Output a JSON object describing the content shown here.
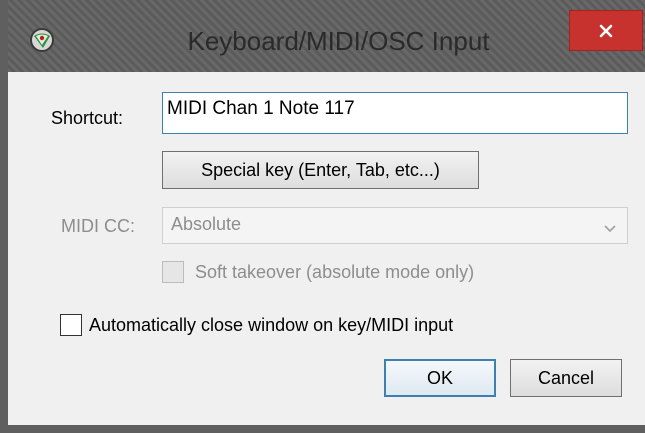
{
  "window": {
    "title": "Keyboard/MIDI/OSC Input"
  },
  "shortcut": {
    "label": "Shortcut:",
    "value": "MIDI Chan 1 Note 117"
  },
  "special_key_button": "Special key (Enter, Tab, etc...)",
  "midi_cc": {
    "label": "MIDI CC:",
    "selected": "Absolute"
  },
  "soft_takeover": {
    "label": "Soft takeover (absolute mode only)",
    "checked": false
  },
  "auto_close": {
    "label": "Automatically close window on key/MIDI input",
    "checked": false
  },
  "buttons": {
    "ok": "OK",
    "cancel": "Cancel"
  },
  "colors": {
    "titlebar": "#5f5f5f",
    "close": "#c7322f",
    "focus_border": "#3c7fb1"
  },
  "icons": {
    "app": "reaper-app-icon",
    "close": "close-icon",
    "dropdown": "chevron-down-icon"
  }
}
